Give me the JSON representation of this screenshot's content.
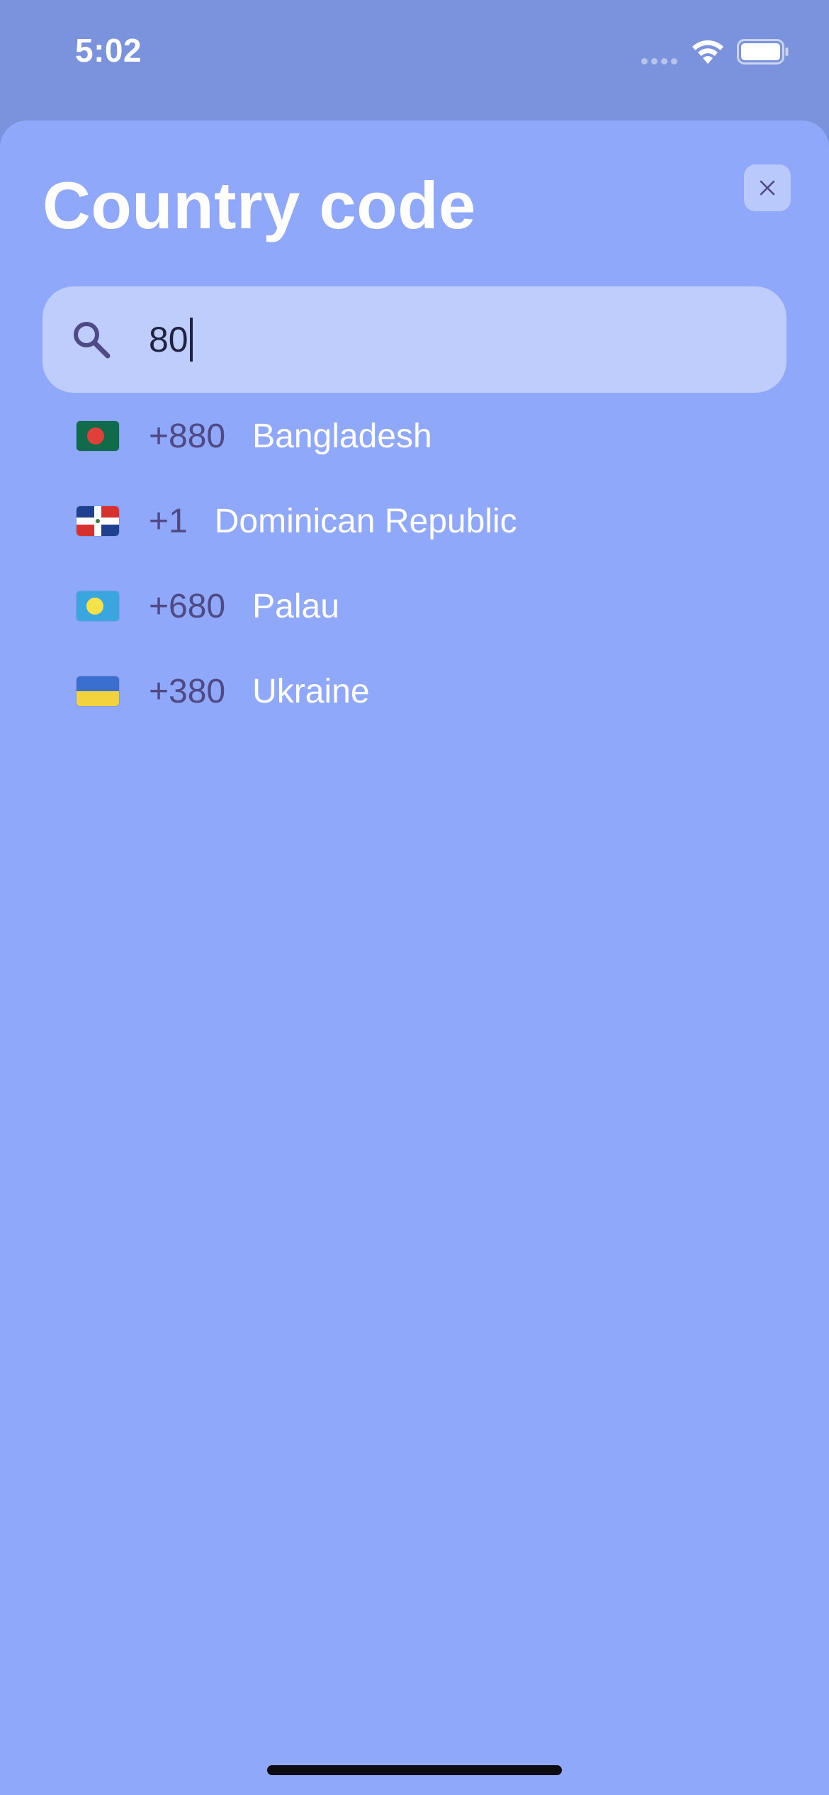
{
  "status_bar": {
    "time": "5:02"
  },
  "sheet": {
    "title": "Country code"
  },
  "search": {
    "value": "80"
  },
  "countries": [
    {
      "flag": "flag-bangladesh",
      "code": "+880",
      "name": "Bangladesh"
    },
    {
      "flag": "flag-dominican-republic",
      "code": "+1",
      "name": "Dominican Republic"
    },
    {
      "flag": "flag-palau",
      "code": "+680",
      "name": "Palau"
    },
    {
      "flag": "flag-ukraine",
      "code": "+380",
      "name": "Ukraine"
    }
  ],
  "colors": {
    "background": "#7b93dc",
    "sheet": "#8fa8f9",
    "search_field": "#bfcdfc",
    "dial_code": "#4f4a86",
    "country_name": "#ffffff"
  }
}
